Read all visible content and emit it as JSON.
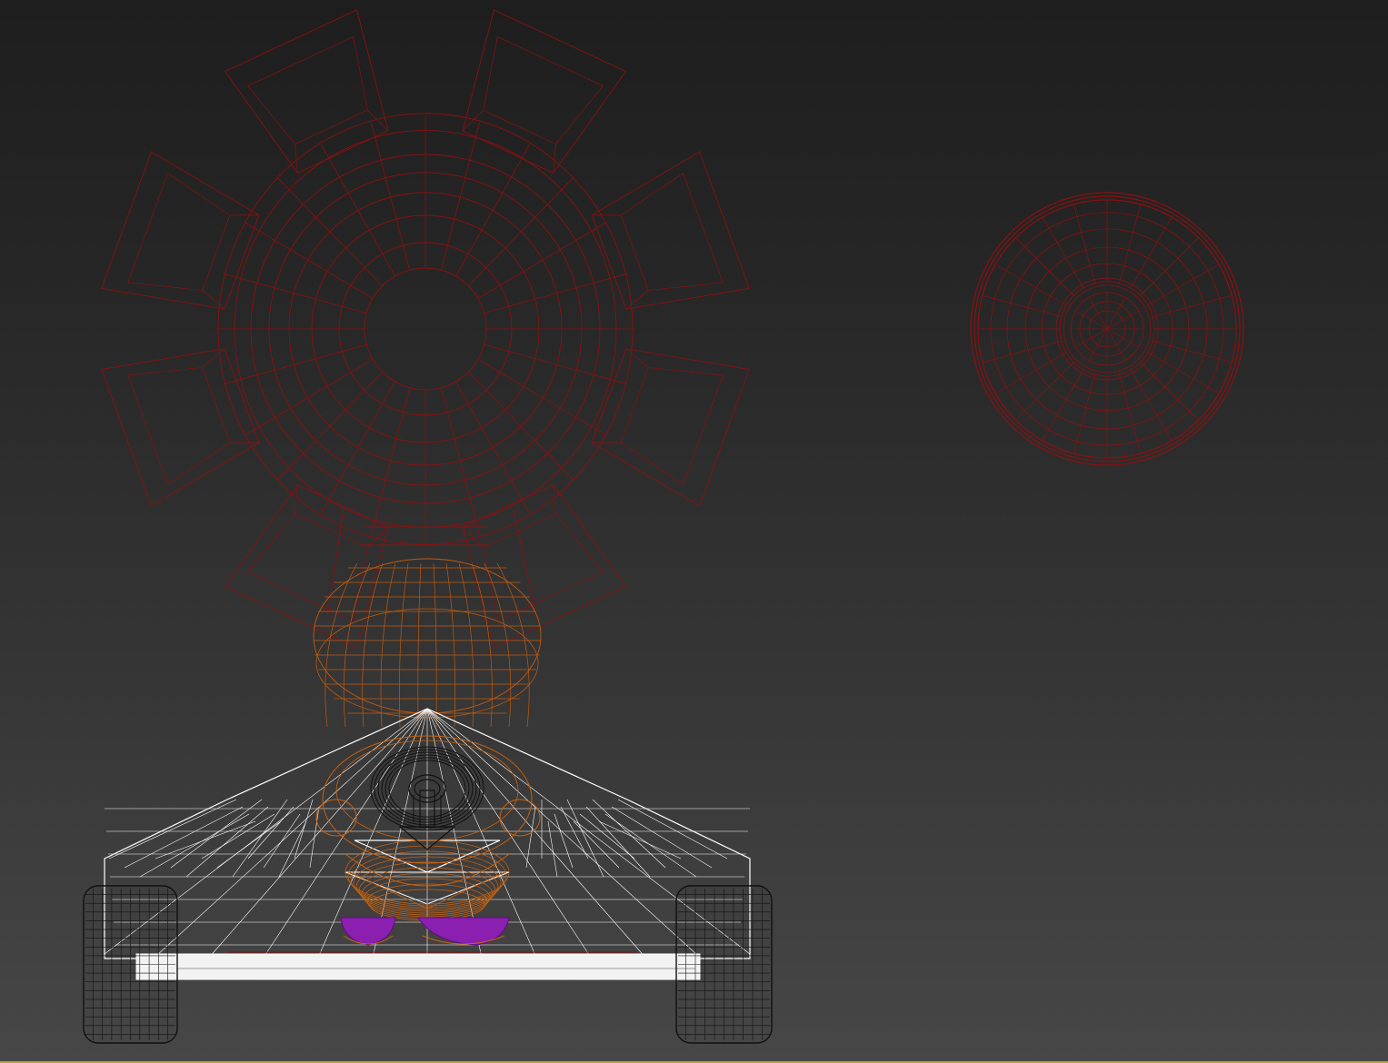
{
  "viewport": {
    "name": "perspective-viewport",
    "background_top": "#1e1e1e",
    "background_bottom": "#474747",
    "active_border_color": "#b8a12a"
  },
  "objects": [
    {
      "name": "helmet-wireframe",
      "color": "#8b1010"
    },
    {
      "name": "wheel-wireframe",
      "color": "#8b1010"
    },
    {
      "name": "character-head-wireframe",
      "color": "#c05a10"
    },
    {
      "name": "kart-body-wireframe",
      "color": "#ffffff"
    },
    {
      "name": "steering-wheel-wireframe",
      "color": "#111111"
    },
    {
      "name": "character-body-wireframe",
      "color": "#c8620f"
    },
    {
      "name": "character-feet-wireframe",
      "color": "#8a1fb0"
    },
    {
      "name": "left-tire-wireframe",
      "color": "#111111"
    },
    {
      "name": "right-tire-wireframe",
      "color": "#111111"
    }
  ]
}
